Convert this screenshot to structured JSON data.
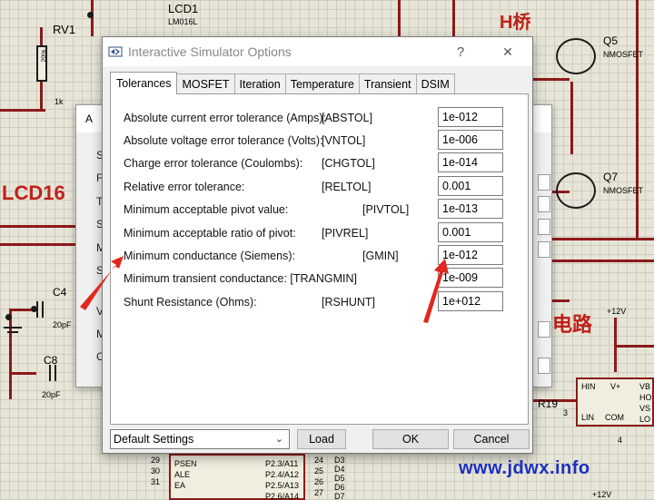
{
  "schematic": {
    "title_h_bridge": "H桥",
    "lcd1_label": "LCD1",
    "lcd1_part": "LM016L",
    "lcd16_label": "LCD16",
    "rv1_label": "RV1",
    "rv1_value": "1k",
    "rv1_pct": "20%",
    "q5_label": "Q5",
    "q5_part": "NMOSFET",
    "q7_label": "Q7",
    "q7_part": "NMOSFET",
    "c4_label": "C4",
    "c4_value": "20pF",
    "c8_label": "C8",
    "c8_value": "20pF",
    "circuit_label": "电路",
    "r19_label": "R19",
    "plus12v_top": "+12V",
    "plus12v_bottom": "+12V",
    "chip_pins": [
      "HIN",
      "V+",
      "VB",
      "HO",
      "VS",
      "LIN",
      "COM",
      "LO"
    ],
    "pin3": "3",
    "pin4": "4",
    "mcu_left_pins": [
      "29",
      "30",
      "31"
    ],
    "mcu_left_labels": [
      "PSEN",
      "ALE",
      "EA"
    ],
    "mcu_right_labels": [
      "P2.3/A11",
      "P2.4/A12",
      "P2.5/A13",
      "P2.6/A14"
    ],
    "mcu_right_nums": [
      "24",
      "25",
      "26",
      "27"
    ],
    "mcu_right_d": [
      "D3",
      "D4",
      "D5",
      "D6",
      "D7"
    ],
    "watermark": "www.jdwx.info"
  },
  "back_dialog": {
    "title": "A",
    "side_letters": [
      "Si",
      "F",
      "T",
      "S",
      "M",
      "S",
      "Vo",
      "M",
      "C"
    ]
  },
  "dialog": {
    "title": "Interactive Simulator Options",
    "help_label": "?",
    "close_label": "✕",
    "tabs": [
      "Tolerances",
      "MOSFET",
      "Iteration",
      "Temperature",
      "Transient",
      "DSIM"
    ],
    "active_tab": "Tolerances",
    "rows": [
      {
        "label": "Absolute current error tolerance (Amps):",
        "key": "[ABSTOL]",
        "value": "1e-012"
      },
      {
        "label": "Absolute voltage error tolerance (Volts):",
        "key": "[VNTOL]",
        "value": "1e-006"
      },
      {
        "label": "Charge error tolerance (Coulombs):",
        "key": "[CHGTOL]",
        "value": "1e-014"
      },
      {
        "label": "Relative error tolerance:",
        "key": "[RELTOL]",
        "value": "0.001"
      },
      {
        "label": "Minimum acceptable pivot value:",
        "key": "[PIVTOL]",
        "value": "1e-013"
      },
      {
        "label": "Minimum acceptable ratio of pivot:",
        "key": "[PIVREL]",
        "value": "0.001"
      },
      {
        "label": "Minimum conductance (Siemens):",
        "key": "[GMIN]",
        "value": "1e-012"
      },
      {
        "label": "Minimum transient conductance: [TRANGMIN]",
        "key": "",
        "value": "1e-009"
      },
      {
        "label": "Shunt Resistance (Ohms):",
        "key": "[RSHUNT]",
        "value": "1e+012"
      }
    ],
    "preset": "Default Settings",
    "load_label": "Load",
    "ok_label": "OK",
    "cancel_label": "Cancel"
  },
  "colors": {
    "wire": "#8b1a1a",
    "accent_red": "#c0201a",
    "arrow_red": "#e0281e",
    "watermark_blue": "#1b2fc0"
  }
}
